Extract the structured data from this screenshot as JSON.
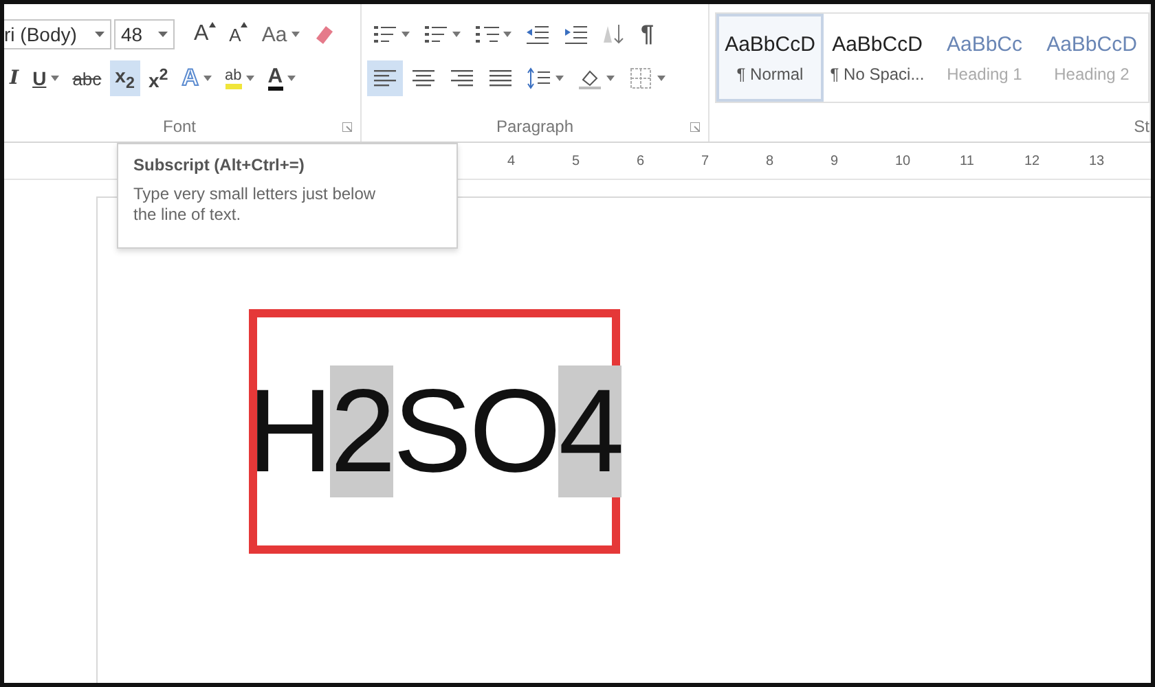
{
  "ribbon": {
    "font_group": {
      "font_name": "ri (Body)",
      "font_size": "48",
      "label": "Font",
      "row1": [
        {
          "kind": "grow",
          "label": "A",
          "dropdown": false
        },
        {
          "kind": "shrink",
          "label": "A",
          "dropdown": false
        },
        {
          "kind": "case",
          "label": "Aa",
          "dropdown": true
        },
        {
          "kind": "clear",
          "dropdown": false
        }
      ],
      "row2": [
        {
          "kind": "italic",
          "label": "I",
          "dropdown": false,
          "selected": false
        },
        {
          "kind": "underline",
          "label": "U",
          "dropdown": true,
          "selected": false
        },
        {
          "kind": "strike",
          "label": "abc",
          "dropdown": false,
          "selected": false
        },
        {
          "kind": "subscript",
          "label": "x$_{2}$",
          "dropdown": false,
          "selected": true
        },
        {
          "kind": "superscript",
          "label": "x$^{2}$",
          "dropdown": false,
          "selected": false
        },
        {
          "kind": "effects",
          "label": "A",
          "dropdown": true,
          "selected": false
        },
        {
          "kind": "highlight",
          "label": "ab",
          "dropdown": true,
          "selected": false
        },
        {
          "kind": "color",
          "label": "A",
          "dropdown": true,
          "selected": false
        }
      ]
    },
    "paragraph_group": {
      "label": "Paragraph",
      "row1": [
        {
          "kind": "bullets",
          "dropdown": true
        },
        {
          "kind": "numbering",
          "dropdown": true
        },
        {
          "kind": "multilevel",
          "dropdown": true
        },
        {
          "kind": "outdent",
          "dropdown": false
        },
        {
          "kind": "indent",
          "dropdown": false
        },
        {
          "kind": "sort",
          "dropdown": false
        },
        {
          "kind": "pilcrow",
          "label": "¶",
          "dropdown": false
        }
      ],
      "row2": [
        {
          "kind": "align-left",
          "dropdown": false,
          "selected": true
        },
        {
          "kind": "align-center",
          "dropdown": false,
          "selected": false
        },
        {
          "kind": "align-right",
          "dropdown": false,
          "selected": false
        },
        {
          "kind": "justify",
          "dropdown": false,
          "selected": false
        },
        {
          "kind": "line-spacing",
          "dropdown": true,
          "selected": false
        },
        {
          "kind": "shading",
          "dropdown": true,
          "selected": false
        },
        {
          "kind": "borders",
          "dropdown": true,
          "selected": false
        }
      ]
    },
    "styles_group": {
      "label": "St",
      "items": [
        {
          "sample": "AaBbCcD",
          "name": "¶ Normal",
          "selected": true
        },
        {
          "sample": "AaBbCcD",
          "name": "¶ No Spaci...",
          "selected": false
        },
        {
          "sample": "AaBbCc",
          "name": "Heading 1",
          "selected": false
        },
        {
          "sample": "AaBbCcD",
          "name": "Heading 2",
          "selected": false
        }
      ]
    }
  },
  "ruler": {
    "numbers": [
      "4",
      "5",
      "6",
      "7",
      "8",
      "9",
      "10",
      "11",
      "12",
      "13"
    ]
  },
  "tooltip": {
    "title": "Subscript (Alt+Ctrl+=)",
    "body": "Type very small letters just below the line of text."
  },
  "document": {
    "segments": [
      {
        "text": "H",
        "selected": false
      },
      {
        "text": "2",
        "selected": true
      },
      {
        "text": "SO",
        "selected": false
      },
      {
        "text": "4",
        "selected": true
      }
    ]
  }
}
